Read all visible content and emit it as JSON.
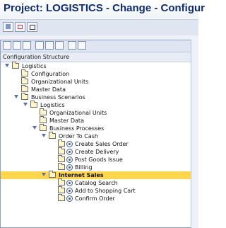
{
  "window": {
    "title": "Project: LOGISTICS - Change - Configur"
  },
  "toolbar": {
    "icons": [
      "toolbar-edit-icon",
      "toolbar-settings-icon",
      "toolbar-layout-icon"
    ]
  },
  "panel_toolbar": {
    "icons": [
      "expand-all-icon",
      "collapse-all-icon",
      "find-icon",
      "find-next-icon",
      "print-icon",
      "export-icon",
      "filter-icon",
      "sort-icon"
    ]
  },
  "tree": {
    "column_header": "Configuration Structure",
    "items": [
      {
        "label": "Logistics",
        "level": 0,
        "type": "folder",
        "expanded": true
      },
      {
        "label": "Configuration",
        "level": 1,
        "type": "folder"
      },
      {
        "label": "Organizational Units",
        "level": 1,
        "type": "folder"
      },
      {
        "label": "Master Data",
        "level": 1,
        "type": "folder"
      },
      {
        "label": "Business Scenarios",
        "level": 1,
        "type": "folder",
        "expanded": true
      },
      {
        "label": "Logistics",
        "level": 2,
        "type": "folder",
        "expanded": true
      },
      {
        "label": "Organizational Units",
        "level": 3,
        "type": "folder"
      },
      {
        "label": "Master Data",
        "level": 3,
        "type": "folder"
      },
      {
        "label": "Business Processes",
        "level": 3,
        "type": "folder",
        "expanded": true
      },
      {
        "label": "Order To Cash",
        "level": 4,
        "type": "folder",
        "expanded": true
      },
      {
        "label": "Create Sales Order",
        "level": 5,
        "type": "activity"
      },
      {
        "label": "Create Delivery",
        "level": 5,
        "type": "activity"
      },
      {
        "label": "Post Goods Issue",
        "level": 5,
        "type": "activity"
      },
      {
        "label": "Billing",
        "level": 5,
        "type": "activity"
      },
      {
        "label": "Internet Sales",
        "level": 4,
        "type": "folder",
        "expanded": true,
        "selected": true
      },
      {
        "label": "Catalog Search",
        "level": 5,
        "type": "activity"
      },
      {
        "label": "Add to Shopping Cart",
        "level": 5,
        "type": "activity"
      },
      {
        "label": "Confirm Order",
        "level": 5,
        "type": "activity"
      }
    ]
  },
  "colors": {
    "selected_row": "#ffd64d",
    "title_text": "#0f2a6e",
    "toolbar_bg": "#dfe6f2"
  }
}
